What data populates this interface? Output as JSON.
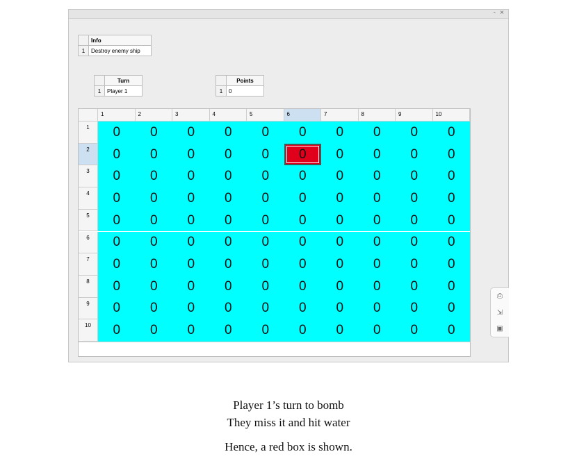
{
  "window": {
    "minimize": "-",
    "close": "×"
  },
  "info_table": {
    "header": "Info",
    "row_index": "1",
    "value": "Destroy enemy ship"
  },
  "turn_table": {
    "header": "Turn",
    "row_index": "1",
    "value": "Player 1"
  },
  "points_table": {
    "header": "Points",
    "row_index": "1",
    "value": "0"
  },
  "board": {
    "column_headers": [
      "1",
      "2",
      "3",
      "4",
      "5",
      "6",
      "7",
      "8",
      "9",
      "10"
    ],
    "row_headers": [
      "1",
      "2",
      "3",
      "4",
      "5",
      "6",
      "7",
      "8",
      "9",
      "10"
    ],
    "selected_column": 6,
    "selected_row": 2,
    "cell_value": "0",
    "hit_cell": {
      "row": 2,
      "col": 6
    },
    "colors": {
      "water": "#00ffff",
      "hit": "#e0001b",
      "selection": "#cde0f2"
    }
  },
  "side_panel": {
    "icons": [
      "print-icon",
      "export-icon",
      "layout-icon"
    ]
  },
  "caption": {
    "line1": "Player 1’s turn to bomb",
    "line2": "They miss it and hit water",
    "line3": "Hence, a red box is shown."
  }
}
